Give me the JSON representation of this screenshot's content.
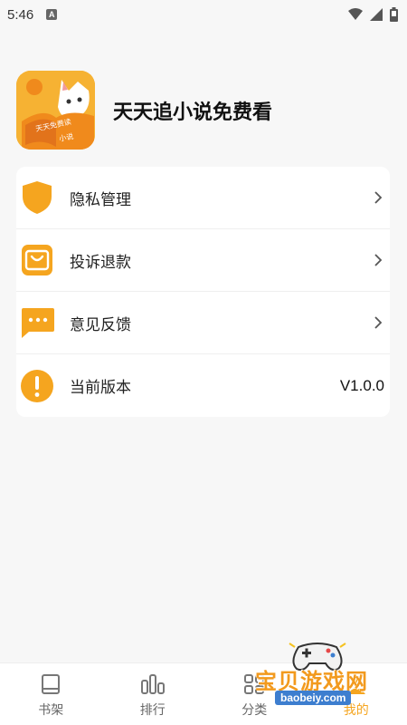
{
  "status_bar": {
    "time": "5:46",
    "notification_badge": "A",
    "icons": [
      "wifi-icon",
      "signal-icon",
      "battery-icon"
    ]
  },
  "app": {
    "title": "天天追小说免费看",
    "logo_text_line1": "天天免费读",
    "logo_text_line2": "小说"
  },
  "menu": {
    "items": [
      {
        "label": "隐私管理",
        "icon": "shield-icon"
      },
      {
        "label": "投诉退款",
        "icon": "shopping-bag-icon"
      },
      {
        "label": "意见反馈",
        "icon": "message-icon"
      },
      {
        "label": "当前版本",
        "icon": "info-icon",
        "value": "V1.0.0"
      }
    ]
  },
  "bottom_nav": {
    "items": [
      {
        "label": "书架",
        "icon": "book-icon"
      },
      {
        "label": "排行",
        "icon": "bar-chart-icon"
      },
      {
        "label": "分类",
        "icon": "grid-icon"
      },
      {
        "label": "我的",
        "icon": "user-icon",
        "active": true
      }
    ]
  },
  "watermark": {
    "text": "宝贝游戏网",
    "url": "baobeiy.com"
  },
  "colors": {
    "accent": "#f5a51f",
    "background": "#f7f7f7",
    "card": "#ffffff"
  }
}
